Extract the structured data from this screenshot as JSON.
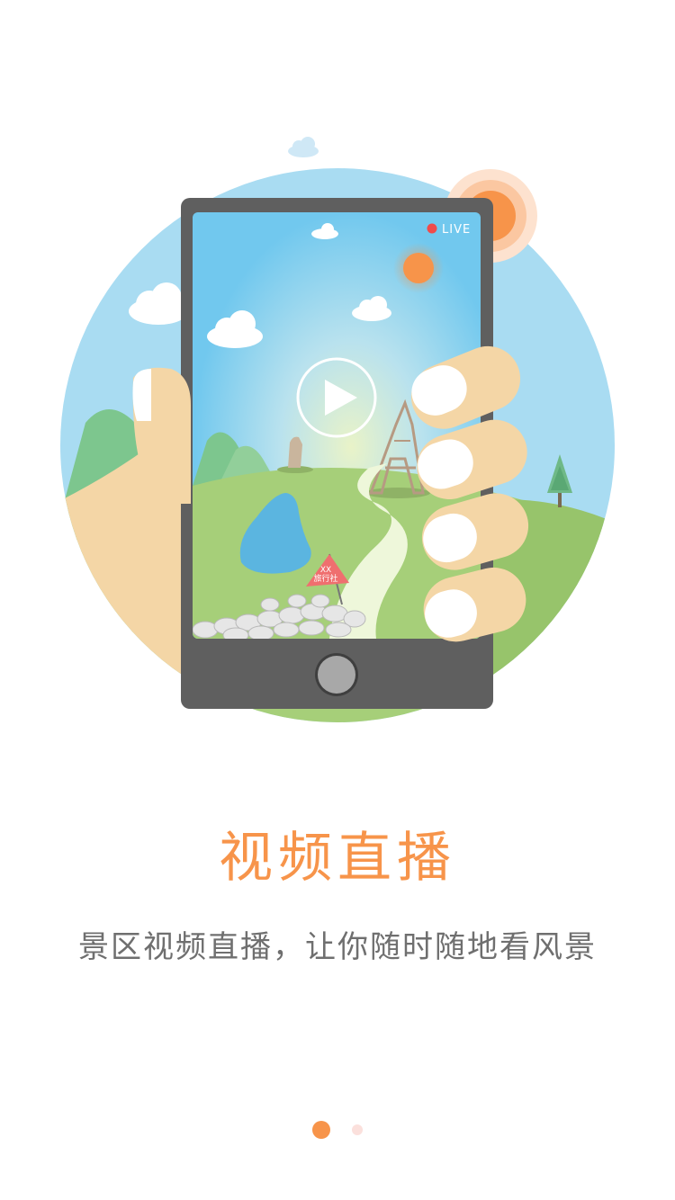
{
  "onboarding": {
    "title": "视频直播",
    "subtitle": "景区视频直播，让你随时随地看风景",
    "pager": {
      "total": 2,
      "current": 1
    }
  },
  "illustration": {
    "live_badge": "LIVE",
    "flag_text_1": "XX",
    "flag_text_2": "旅行社",
    "icons": [
      "play-icon",
      "home-button-icon",
      "sun-icon",
      "cloud-icon",
      "tree-icon",
      "tower-icon",
      "statue-icon"
    ]
  },
  "colors": {
    "accent": "#f7944a",
    "sky": "#a9dcf2",
    "grass": "#a6cf79",
    "phone_body": "#5f5f5f",
    "skin": "#f4d6a6",
    "live_dot": "#f04b4b"
  }
}
